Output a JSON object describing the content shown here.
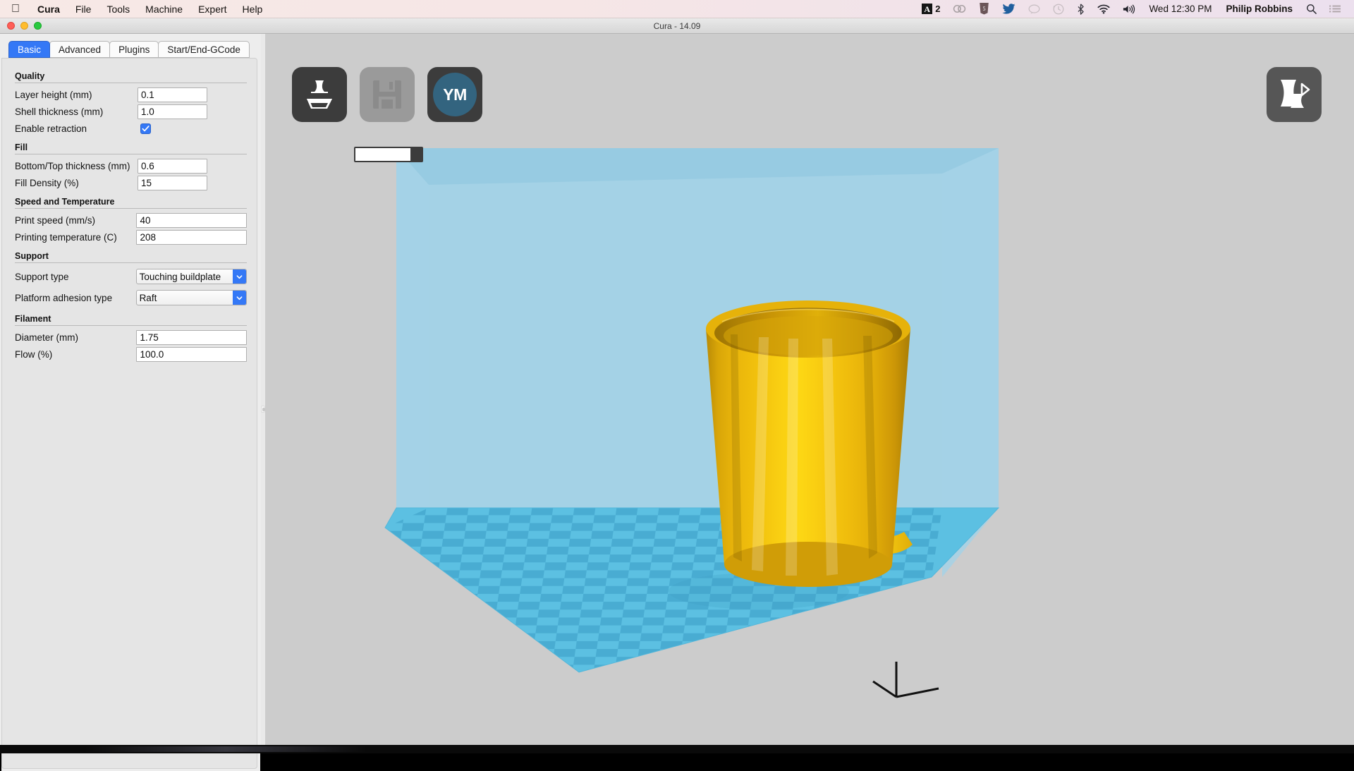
{
  "menubar": {
    "apple_icon": "apple-logo-icon",
    "items": [
      "Cura",
      "File",
      "Tools",
      "Machine",
      "Expert",
      "Help"
    ],
    "status_icons": [
      "adobe-creative-cloud-icon",
      "html5-icon",
      "twitter-icon",
      "messages-bubble-icon",
      "time-machine-icon",
      "bluetooth-icon",
      "wifi-icon",
      "volume-icon"
    ],
    "adobe_badge_letter": "A",
    "adobe_badge_count": "2",
    "clock": "Wed 12:30 PM",
    "username": "Philip Robbins",
    "search_icon": "spotlight-search-icon",
    "notification_icon": "notification-center-icon"
  },
  "window": {
    "title": "Cura - 14.09",
    "close_label": "close",
    "minimize_label": "minimize",
    "zoom_label": "zoom"
  },
  "sidebar": {
    "tabs": [
      {
        "label": "Basic",
        "active": true
      },
      {
        "label": "Advanced",
        "active": false
      },
      {
        "label": "Plugins",
        "active": false
      },
      {
        "label": "Start/End-GCode",
        "active": false
      }
    ],
    "groups": [
      {
        "title": "Quality",
        "rows": [
          {
            "label": "Layer height (mm)",
            "value": "0.1",
            "type": "text",
            "width": "short"
          },
          {
            "label": "Shell thickness (mm)",
            "value": "1.0",
            "type": "text",
            "width": "short"
          },
          {
            "label": "Enable retraction",
            "value": "",
            "type": "checkbox",
            "checked": true
          }
        ]
      },
      {
        "title": "Fill",
        "rows": [
          {
            "label": "Bottom/Top thickness (mm)",
            "value": "0.6",
            "type": "text",
            "width": "short"
          },
          {
            "label": "Fill Density (%)",
            "value": "15",
            "type": "text",
            "width": "short"
          }
        ]
      },
      {
        "title": "Speed and Temperature",
        "rows": [
          {
            "label": "Print speed (mm/s)",
            "value": "40",
            "type": "text",
            "width": "long"
          },
          {
            "label": "Printing temperature (C)",
            "value": "208",
            "type": "text",
            "width": "long"
          }
        ]
      },
      {
        "title": "Support",
        "rows": [
          {
            "label": "Support type",
            "value": "Touching buildplate",
            "type": "select"
          },
          {
            "label": "Platform adhesion type",
            "value": "Raft",
            "type": "select"
          }
        ]
      },
      {
        "title": "Filament",
        "rows": [
          {
            "label": "Diameter (mm)",
            "value": "1.75",
            "type": "text",
            "width": "long"
          },
          {
            "label": "Flow (%)",
            "value": "100.0",
            "type": "text",
            "width": "long"
          }
        ]
      }
    ]
  },
  "viewport": {
    "toolbar": [
      {
        "name": "load-model-button",
        "icon": "load-model-icon",
        "enabled": true
      },
      {
        "name": "save-toolpath-button",
        "icon": "floppy-disk-save-icon",
        "enabled": false
      },
      {
        "name": "share-youmagine-button",
        "icon": "youmagine-icon",
        "label": "YM",
        "enabled": true
      }
    ],
    "progress_label": "",
    "view_mode_button": "view-mode-icon",
    "scene": {
      "model_name": "tapered-cup-with-handle",
      "model_color": "#f5c40f",
      "buildplate_color": "#4bb8e0",
      "buildvolume_color": "#9fd3e8",
      "background_color": "#cccccc",
      "axis_indicator": "origin-axis-icon"
    }
  },
  "colors": {
    "accent": "#3478f6",
    "panel_bg": "#e5e5e5",
    "viewport_bg": "#cccccc",
    "model_gold": "#f5c40f",
    "plate_blue": "#4bb8e0"
  }
}
